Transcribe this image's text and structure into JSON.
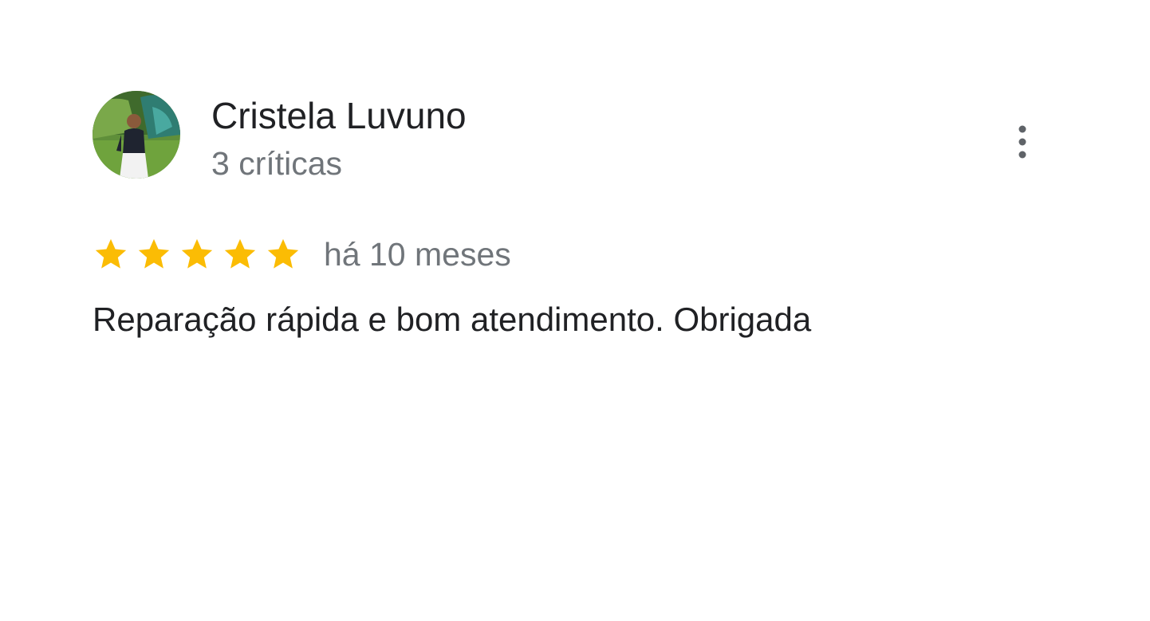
{
  "review": {
    "author_name": "Cristela Luvuno",
    "review_count": "3 críticas",
    "rating": 5,
    "rating_max": 5,
    "time_ago": "há 10 meses",
    "text": "Reparação rápida e bom atendimento. Obrigada",
    "star_color": "#fbbc04",
    "avatar_icon": "user-photo-avatar",
    "more_icon": "more-vert-icon"
  }
}
